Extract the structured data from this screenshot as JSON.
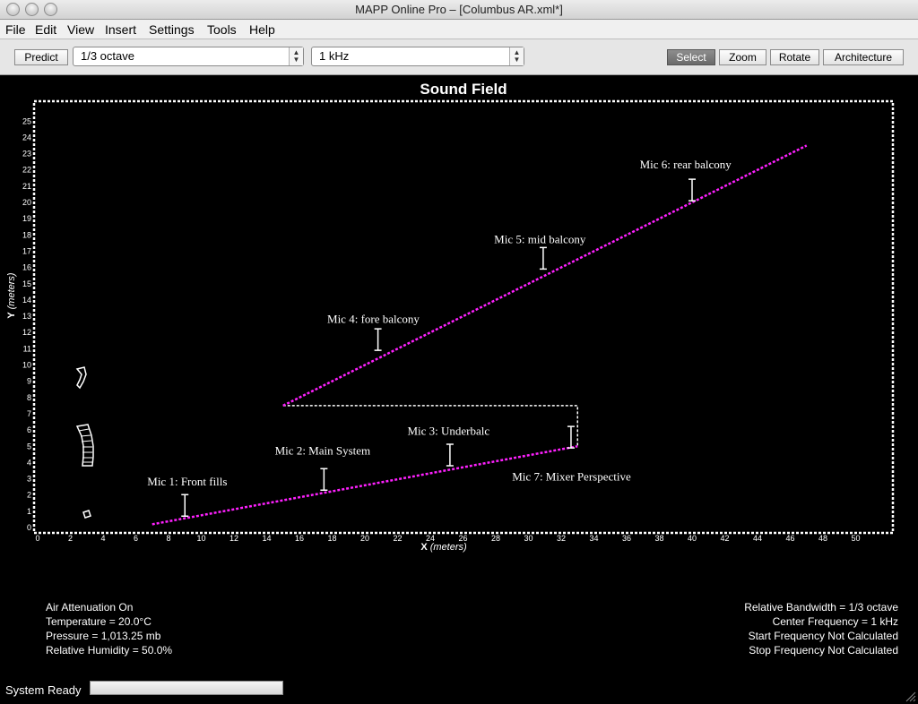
{
  "window": {
    "title": "MAPP Online Pro – [Columbus AR.xml*]"
  },
  "menu": [
    "File",
    "Edit",
    "View",
    "Insert",
    "Settings",
    "Tools",
    "Help"
  ],
  "toolbar": {
    "predict_label": "Predict",
    "bandwidth_value": "1/3 octave",
    "frequency_value": "1 kHz",
    "modes": [
      {
        "label": "Select",
        "active": true
      },
      {
        "label": "Zoom",
        "active": false
      },
      {
        "label": "Rotate",
        "active": false
      },
      {
        "label": "Architecture",
        "active": false
      }
    ]
  },
  "plot": {
    "title": "Sound Field",
    "xlabel": "X",
    "ylabel": "Y",
    "unit": "(meters)",
    "xlim": [
      0,
      52
    ],
    "ylim": [
      0,
      26
    ],
    "line_color": "#ff20ff",
    "upper_line": [
      [
        15,
        7.5
      ],
      [
        47,
        23.5
      ]
    ],
    "lower_line": [
      [
        7,
        0.2
      ],
      [
        33,
        5.0
      ]
    ],
    "mixer_box": [
      [
        15,
        7.5
      ],
      [
        33,
        7.5
      ],
      [
        33,
        5.0
      ]
    ],
    "mics": [
      {
        "label": "Mic 1: Front fills",
        "x": 9,
        "y": 0.7,
        "lx": 6.7,
        "ly": 2.6
      },
      {
        "label": "Mic 2: Main System",
        "x": 17.5,
        "y": 2.3,
        "lx": 14.5,
        "ly": 4.5
      },
      {
        "label": "Mic 3: Underbalc",
        "x": 25.2,
        "y": 3.8,
        "lx": 22.6,
        "ly": 5.7
      },
      {
        "label": "Mic 4: fore balcony",
        "x": 20.8,
        "y": 10.9,
        "lx": 17.7,
        "ly": 12.6
      },
      {
        "label": "Mic 5: mid balcony",
        "x": 30.9,
        "y": 15.9,
        "lx": 27.9,
        "ly": 17.5
      },
      {
        "label": "Mic 6: rear balcony",
        "x": 40,
        "y": 20.1,
        "lx": 36.8,
        "ly": 22.1
      },
      {
        "label": "Mic 7: Mixer Perspective",
        "x": 32.6,
        "y": 4.9,
        "lx": 29.0,
        "ly": 2.9
      }
    ]
  },
  "info_left": {
    "line1": "Air Attenuation On",
    "line2": "Temperature = 20.0°C",
    "line3": "Pressure = 1,013.25  mb",
    "line4": "Relative Humidity = 50.0%"
  },
  "info_right": {
    "line1": "Relative Bandwidth = 1/3 octave",
    "line2": "Center Frequency = 1 kHz",
    "line3": "Start Frequency Not Calculated",
    "line4": "Stop Frequency Not Calculated"
  },
  "status": {
    "text": "System Ready",
    "progress": 0
  }
}
